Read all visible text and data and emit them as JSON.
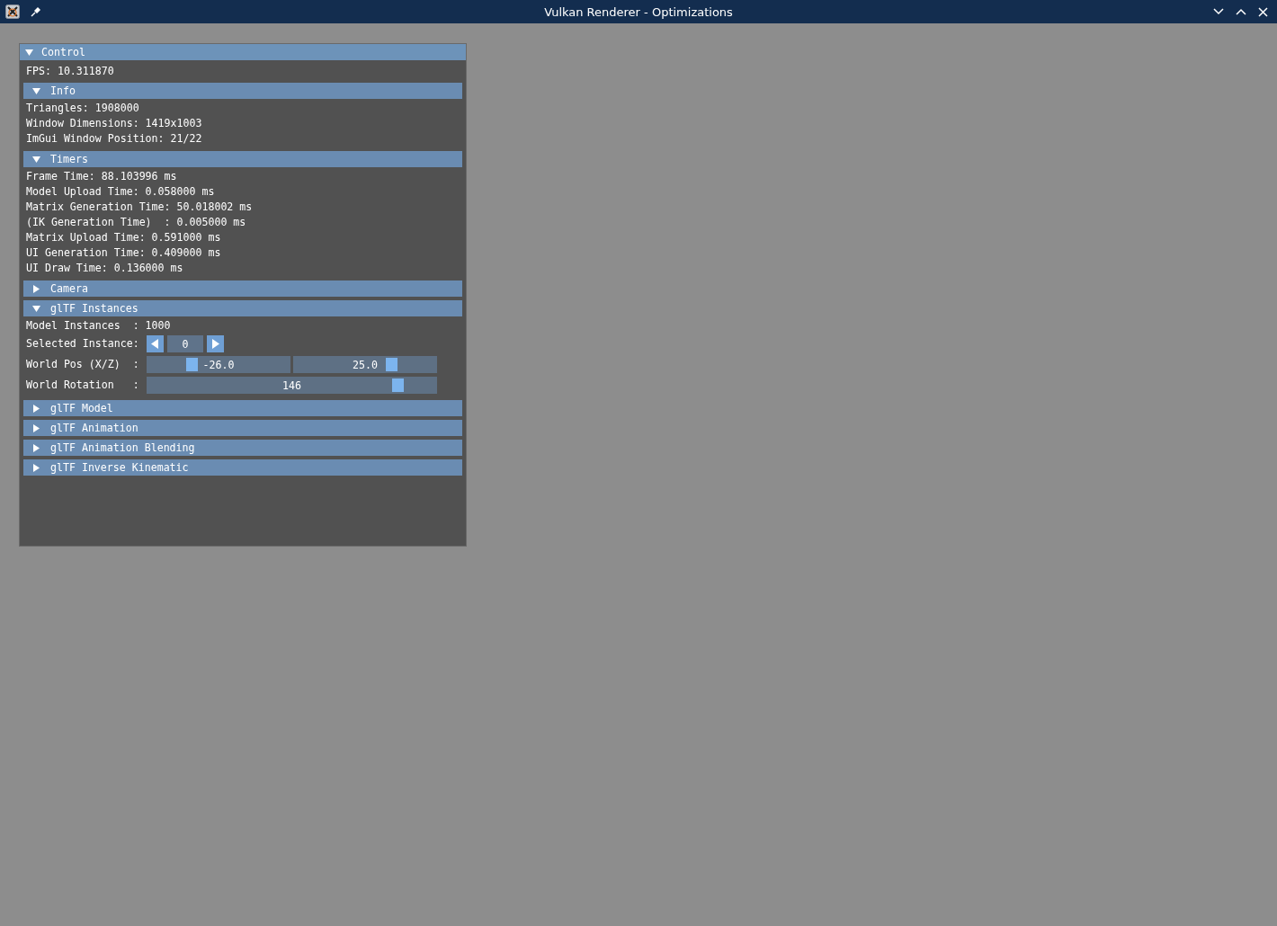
{
  "window": {
    "title": "Vulkan Renderer - Optimizations"
  },
  "panel": {
    "title": "Control",
    "expanded": true,
    "fps": "FPS: 10.311870",
    "sections": [
      {
        "title": "Info",
        "expanded": true,
        "items": [
          {
            "kind": "text",
            "text": "Triangles: 1908000"
          },
          {
            "kind": "text",
            "text": "Window Dimensions: 1419x1003"
          },
          {
            "kind": "text",
            "text": "ImGui Window Position: 21/22"
          }
        ]
      },
      {
        "title": "Timers",
        "expanded": true,
        "items": [
          {
            "kind": "text",
            "text": "Frame Time: 88.103996 ms"
          },
          {
            "kind": "text",
            "text": "Model Upload Time: 0.058000 ms"
          },
          {
            "kind": "text",
            "text": "Matrix Generation Time: 50.018002 ms"
          },
          {
            "kind": "text",
            "text": "(IK Generation Time)  : 0.005000 ms"
          },
          {
            "kind": "text",
            "text": "Matrix Upload Time: 0.591000 ms"
          },
          {
            "kind": "text",
            "text": "UI Generation Time: 0.409000 ms"
          },
          {
            "kind": "text",
            "text": "UI Draw Time: 0.136000 ms"
          }
        ]
      },
      {
        "title": "Camera",
        "expanded": false
      },
      {
        "title": "glTF Instances",
        "expanded": true,
        "items": [
          {
            "kind": "text",
            "text": "Model Instances  : 1000"
          },
          {
            "kind": "stepper",
            "label": "Selected Instance:",
            "value": "0"
          },
          {
            "kind": "slider2",
            "label": "World Pos (X/Z)  :",
            "sliders": [
              {
                "reading": "-26.0",
                "level": 0.3
              },
              {
                "reading": "25.0",
                "level": 0.7
              }
            ]
          },
          {
            "kind": "slider",
            "label": "World Rotation   :",
            "sliders": [
              {
                "reading": "146",
                "level": 0.88
              }
            ]
          }
        ]
      },
      {
        "title": "glTF Model",
        "expanded": false
      },
      {
        "title": "glTF Animation",
        "expanded": false
      },
      {
        "title": "glTF Animation Blending",
        "expanded": false
      },
      {
        "title": "glTF Inverse Kinematic",
        "expanded": false
      }
    ]
  }
}
